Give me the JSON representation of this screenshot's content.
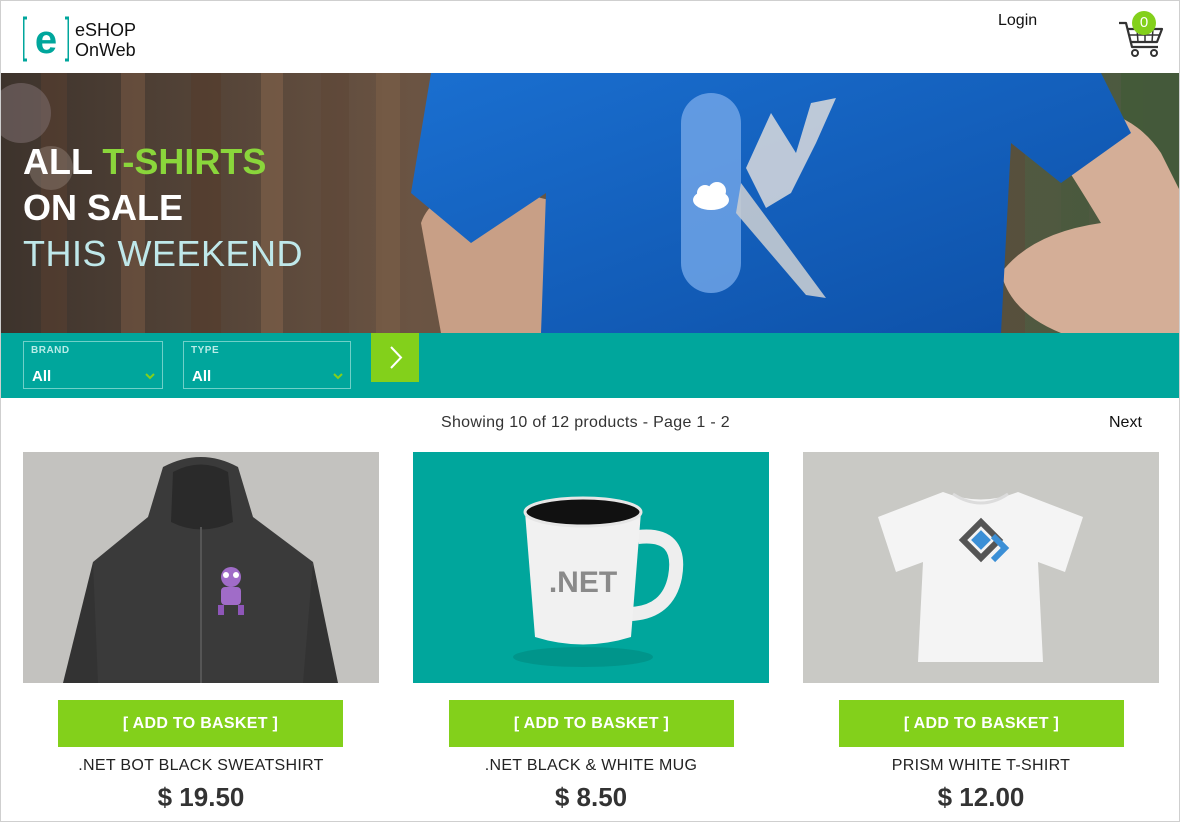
{
  "header": {
    "logo_line1": "eSHOP",
    "logo_line2": "OnWeb",
    "login_label": "Login",
    "cart_count": "0"
  },
  "hero": {
    "line1_part1": "ALL ",
    "line1_part2": "T-SHIRTS",
    "line2": "ON SALE",
    "line3": "THIS WEEKEND"
  },
  "filters": {
    "brand": {
      "label": "BRAND",
      "value": "All"
    },
    "type": {
      "label": "TYPE",
      "value": "All"
    }
  },
  "pagination": {
    "info": "Showing 10 of 12 products - Page 1 - 2",
    "next_label": "Next"
  },
  "products": [
    {
      "name": ".NET BOT BLACK SWEATSHIRT",
      "price": "$ 19.50",
      "button": "[ ADD TO BASKET ]"
    },
    {
      "name": ".NET BLACK & WHITE MUG",
      "price": "$ 8.50",
      "button": "[ ADD TO BASKET ]",
      "mug_text": ".NET"
    },
    {
      "name": "PRISM WHITE T-SHIRT",
      "price": "$ 12.00",
      "button": "[ ADD TO BASKET ]"
    }
  ],
  "colors": {
    "brand_teal": "#00a69c",
    "accent_green": "#83d01b",
    "hero_blue": "#1565c0"
  }
}
